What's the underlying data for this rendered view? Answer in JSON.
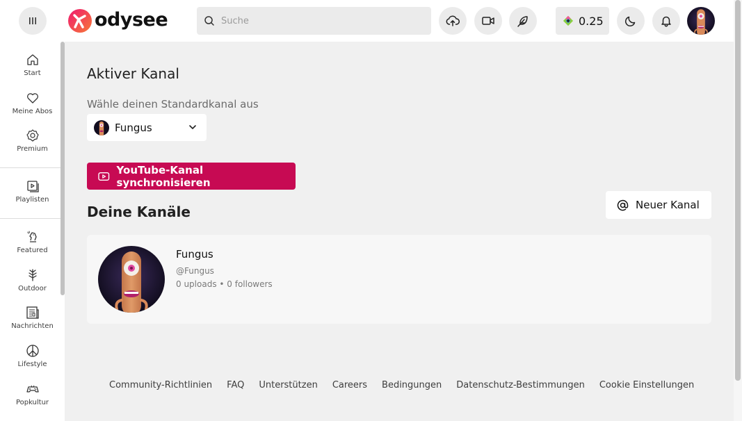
{
  "header": {
    "logo_text": "odysee",
    "search_placeholder": "Suche",
    "wallet_balance": "0.25",
    "icons": [
      "menu-icon",
      "upload-icon",
      "video-icon",
      "feather-icon",
      "credits-icon",
      "moon-icon",
      "bell-icon"
    ]
  },
  "sidebar": {
    "items": [
      {
        "label": "Start",
        "icon": "home-icon"
      },
      {
        "label": "Meine Abos",
        "icon": "heart-icon"
      },
      {
        "label": "Premium",
        "icon": "premium-badge-icon"
      },
      {
        "label": "Playlisten",
        "icon": "playlist-icon"
      },
      {
        "label": "Featured",
        "icon": "chess-knight-icon"
      },
      {
        "label": "Outdoor",
        "icon": "tree-icon"
      },
      {
        "label": "Nachrichten",
        "icon": "newspaper-icon"
      },
      {
        "label": "Lifestyle",
        "icon": "peace-icon"
      },
      {
        "label": "Popkultur",
        "icon": "gamepad-icon"
      }
    ]
  },
  "main": {
    "active_heading": "Aktiver Kanal",
    "select_label": "Wähle deinen Standardkanal aus",
    "selected_channel": "Fungus",
    "sync_button": "YouTube-Kanal synchronisieren",
    "channels_heading": "Deine Kanäle",
    "new_channel_button": "Neuer Kanal",
    "channel_card": {
      "name": "Fungus",
      "handle": "@Fungus",
      "stats": "0 uploads • 0 followers"
    }
  },
  "footer": {
    "links": [
      "Community-Richtlinien",
      "FAQ",
      "Unterstützen",
      "Careers",
      "Bedingungen",
      "Datenschutz-Bestimmungen",
      "Cookie Einstellungen"
    ]
  },
  "colors": {
    "accent": "#c70a53",
    "background": "#f0f0f0",
    "surface": "#ffffff"
  }
}
